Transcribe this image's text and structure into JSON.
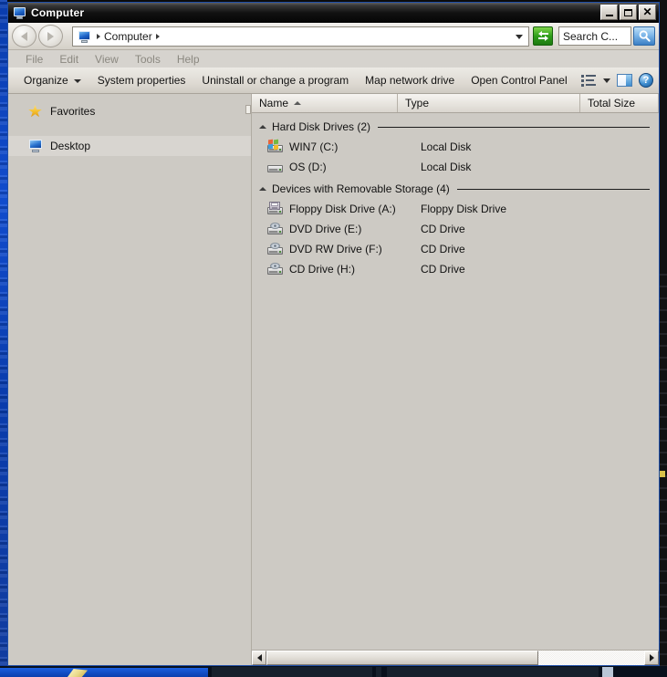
{
  "window": {
    "title": "Computer",
    "title_icon": "computer-monitor-icon",
    "controls": {
      "minimize": "_",
      "maximize": "□",
      "close": "×"
    }
  },
  "address_bar": {
    "back_icon": "arrow-left-icon",
    "forward_icon": "arrow-right-icon",
    "crumb": "Computer",
    "crumb_icon": "computer-monitor-icon",
    "dropdown_icon": "chevron-down-icon",
    "refresh_icon": "refresh-icon",
    "search_placeholder": "Search C...",
    "search_value": "",
    "search_icon": "magnifier-icon"
  },
  "menu_bar": {
    "items": [
      {
        "label": "File"
      },
      {
        "label": "Edit"
      },
      {
        "label": "View"
      },
      {
        "label": "Tools"
      },
      {
        "label": "Help"
      }
    ]
  },
  "command_bar": {
    "items": [
      {
        "label": "Organize",
        "has_caret": true
      },
      {
        "label": "System properties",
        "has_caret": false
      },
      {
        "label": "Uninstall or change a program",
        "has_caret": false
      },
      {
        "label": "Map network drive",
        "has_caret": false
      },
      {
        "label": "Open Control Panel",
        "has_caret": false
      }
    ],
    "views_icon": "list-view-icon",
    "views_caret_icon": "chevron-down-icon",
    "preview_pane_icon": "preview-pane-icon",
    "help_icon": "help-question-icon",
    "help_glyph": "?"
  },
  "nav_pane": {
    "items": [
      {
        "label": "Favorites",
        "icon": "star-icon",
        "selected": false
      },
      {
        "label": "Desktop",
        "icon": "desktop-monitor-icon",
        "selected": true
      }
    ]
  },
  "list": {
    "columns": [
      {
        "label": "Name",
        "sorted": true,
        "sort_icon": "sort-ascending-icon"
      },
      {
        "label": "Type",
        "sorted": false
      },
      {
        "label": "Total Size",
        "sorted": false
      }
    ],
    "groups": [
      {
        "label": "Hard Disk Drives (2)",
        "caret_icon": "collapse-caret-icon",
        "rows": [
          {
            "name": "WIN7 (C:)",
            "type": "Local Disk",
            "size": "",
            "icon": "windows-drive-icon"
          },
          {
            "name": "OS (D:)",
            "type": "Local Disk",
            "size": "",
            "icon": "hard-drive-icon"
          }
        ]
      },
      {
        "label": "Devices with Removable Storage (4)",
        "caret_icon": "collapse-caret-icon",
        "rows": [
          {
            "name": "Floppy Disk Drive (A:)",
            "type": "Floppy Disk Drive",
            "size": "",
            "icon": "floppy-drive-icon"
          },
          {
            "name": "DVD Drive (E:)",
            "type": "CD Drive",
            "size": "",
            "icon": "optical-drive-icon"
          },
          {
            "name": "DVD RW Drive (F:)",
            "type": "CD Drive",
            "size": "",
            "icon": "optical-drive-icon"
          },
          {
            "name": "CD Drive (H:)",
            "type": "CD Drive",
            "size": "",
            "icon": "optical-drive-icon"
          }
        ]
      }
    ]
  },
  "scrollbar": {
    "left_arrow_icon": "scroll-left-icon",
    "right_arrow_icon": "scroll-right-icon"
  },
  "colors": {
    "window_face": "#d6d3ce",
    "list_background": "#cdcac4",
    "title_bar": "#101010",
    "accent_blue": "#1f4fa8",
    "refresh_green": "#2f9e1a"
  }
}
